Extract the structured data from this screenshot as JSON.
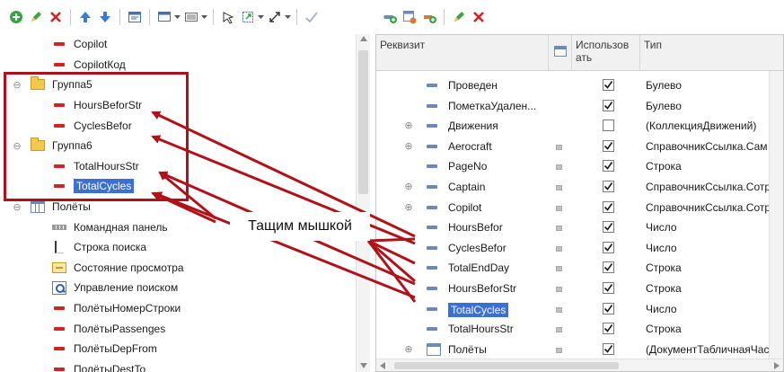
{
  "left_toolbar": {
    "buttons": [
      {
        "icon": "add-icon"
      },
      {
        "icon": "edit-icon"
      },
      {
        "icon": "delete-icon"
      },
      {
        "icon": "move-up-icon"
      },
      {
        "icon": "move-down-icon"
      },
      {
        "icon": "form-icon"
      },
      {
        "icon": "window-dropdown-icon"
      },
      {
        "icon": "panel-dropdown-icon"
      },
      {
        "icon": "cursor-icon"
      },
      {
        "icon": "size-dropdown-icon"
      },
      {
        "icon": "arrows-dropdown-icon"
      },
      {
        "icon": "check-icon"
      }
    ]
  },
  "left_tree": [
    {
      "label": "Copilot",
      "icon": "red-dash-icon",
      "level": 2
    },
    {
      "label": "CopilotКод",
      "icon": "red-dash-icon",
      "level": 2
    },
    {
      "label": "Группа5",
      "icon": "folder-icon",
      "level": 1,
      "expander": "⊖"
    },
    {
      "label": "HoursBeforStr",
      "icon": "red-dash-icon",
      "level": 2
    },
    {
      "label": "CyclesBefor",
      "icon": "red-dash-icon",
      "level": 2
    },
    {
      "label": "Группа6",
      "icon": "folder-icon",
      "level": 1,
      "expander": "⊖"
    },
    {
      "label": "TotalHoursStr",
      "icon": "red-dash-icon",
      "level": 2
    },
    {
      "label": "TotalCycles",
      "icon": "red-dash-icon",
      "level": 2,
      "selected": true
    },
    {
      "label": "Полёты",
      "icon": "table-icon",
      "level": 1,
      "expander": "⊖"
    },
    {
      "label": "Командная панель",
      "icon": "command-bar-icon",
      "level": 2
    },
    {
      "label": "Строка поиска",
      "icon": "search-line-icon",
      "level": 2
    },
    {
      "label": "Состояние просмотра",
      "icon": "view-state-icon",
      "level": 2
    },
    {
      "label": "Управление поиском",
      "icon": "search-manager-icon",
      "level": 2
    },
    {
      "label": "ПолётыНомерСтроки",
      "icon": "red-dash-icon",
      "level": 2
    },
    {
      "label": "ПолётыPassenges",
      "icon": "red-dash-icon",
      "level": 2
    },
    {
      "label": "ПолётыDepFrom",
      "icon": "red-dash-icon",
      "level": 2
    },
    {
      "label": "ПолётыDestTo",
      "icon": "red-dash-icon",
      "level": 2
    }
  ],
  "right_toolbar": {
    "buttons": [
      {
        "icon": "add-attribute-icon"
      },
      {
        "icon": "add-table-icon"
      },
      {
        "icon": "add-column-icon"
      },
      {
        "icon": "edit-icon"
      },
      {
        "icon": "delete-icon"
      }
    ]
  },
  "right_grid": {
    "headers": {
      "requisite": "Реквизит",
      "use_line1": "Использов",
      "use_line2": "ать",
      "type": "Тип"
    },
    "rows": [
      {
        "label": "Проведен",
        "expander": "",
        "mark": false,
        "checked": true,
        "type": "Булево"
      },
      {
        "label": "ПометкаУдален...",
        "expander": "",
        "mark": false,
        "checked": true,
        "type": "Булево"
      },
      {
        "label": "Движения",
        "expander": "⊕",
        "mark": false,
        "checked": false,
        "type": "(КоллекцияДвижений)"
      },
      {
        "label": "Aerocraft",
        "expander": "⊕",
        "mark": true,
        "checked": true,
        "type": "СправочникСсылка.Сам"
      },
      {
        "label": "PageNo",
        "expander": "",
        "mark": true,
        "checked": true,
        "type": "Строка"
      },
      {
        "label": "Captain",
        "expander": "⊕",
        "mark": true,
        "checked": true,
        "type": "СправочникСсылка.Сотр"
      },
      {
        "label": "Copilot",
        "expander": "⊕",
        "mark": true,
        "checked": true,
        "type": "СправочникСсылка.Сотр"
      },
      {
        "label": "HoursBefor",
        "expander": "",
        "mark": true,
        "checked": true,
        "type": "Число"
      },
      {
        "label": "CyclesBefor",
        "expander": "",
        "mark": true,
        "checked": true,
        "type": "Число"
      },
      {
        "label": "TotalEndDay",
        "expander": "",
        "mark": true,
        "checked": true,
        "type": "Строка"
      },
      {
        "label": "HoursBeforStr",
        "expander": "",
        "mark": true,
        "checked": true,
        "type": "Строка"
      },
      {
        "label": "TotalCycles",
        "expander": "",
        "mark": true,
        "checked": true,
        "type": "Число",
        "selected": true
      },
      {
        "label": "TotalHoursStr",
        "expander": "",
        "mark": true,
        "checked": true,
        "type": "Строка"
      },
      {
        "label": "Полёты",
        "expander": "⊕",
        "mark": true,
        "checked": true,
        "type": "(ДокументТабличнаяЧас",
        "table": true
      }
    ]
  },
  "annotation": {
    "label": "Тащим мышкой",
    "color": "#b1121a"
  },
  "colors": {
    "selection": "#3b6fd1",
    "red_field": "#d22323",
    "blue_field": "#6b88b6"
  }
}
